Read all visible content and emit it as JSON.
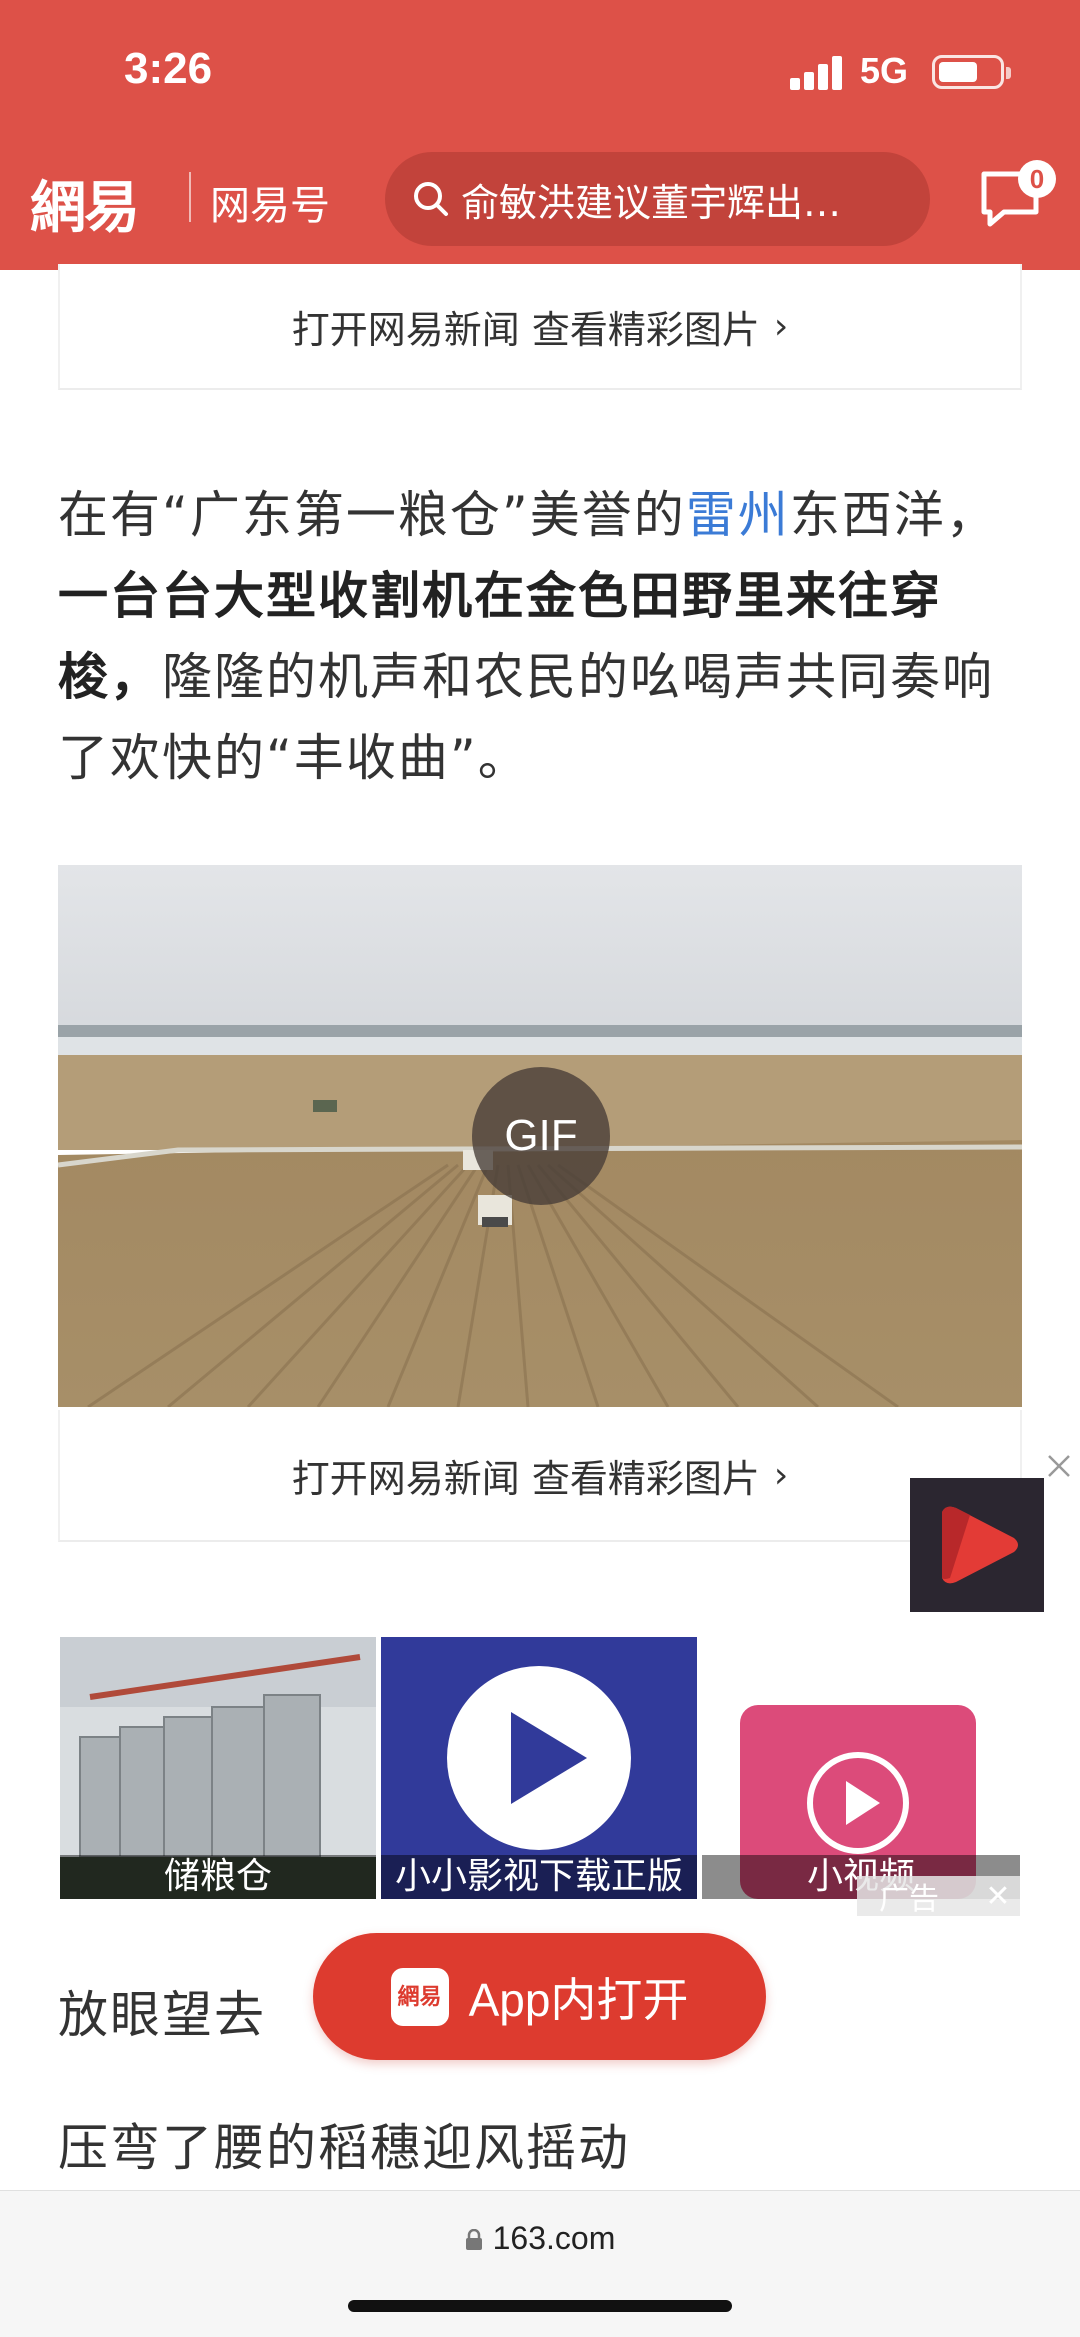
{
  "status_bar": {
    "time": "3:26",
    "network": "5G"
  },
  "nav": {
    "logo": "網易",
    "channel": "网易号",
    "search_text": "俞敏洪建议董宇辉出…",
    "message_badge": "0"
  },
  "article": {
    "open_card_text": "打开网易新闻 查看精彩图片",
    "paragraph": {
      "part1": "在有“广东第一粮仓”美誉的",
      "link": "雷州",
      "part2": "东西洋，",
      "bold": "一台台大型收割机在金色田野里来往穿梭，",
      "part3": "隆隆的机声和农民的吆喝声共同奏响了欢快的“丰收曲”。"
    },
    "gif_label": "GIF",
    "open_card_text_2": "打开网易新闻 查看精彩图片",
    "caption1": "放眼望去",
    "caption2": "压弯了腰的稻穗迎风摇动"
  },
  "ads": {
    "tiles": [
      {
        "label": "储粮仓"
      },
      {
        "label": "小小影视下载正版"
      },
      {
        "label": "小视频"
      }
    ],
    "ad_mark": "广告"
  },
  "open_app": {
    "icon_text": "網易",
    "label": "App内打开"
  },
  "browser": {
    "url": "163.com"
  },
  "colors": {
    "brand_red": "#dd5148",
    "button_red": "#dd3b2f",
    "link_blue": "#3b7bd6"
  }
}
